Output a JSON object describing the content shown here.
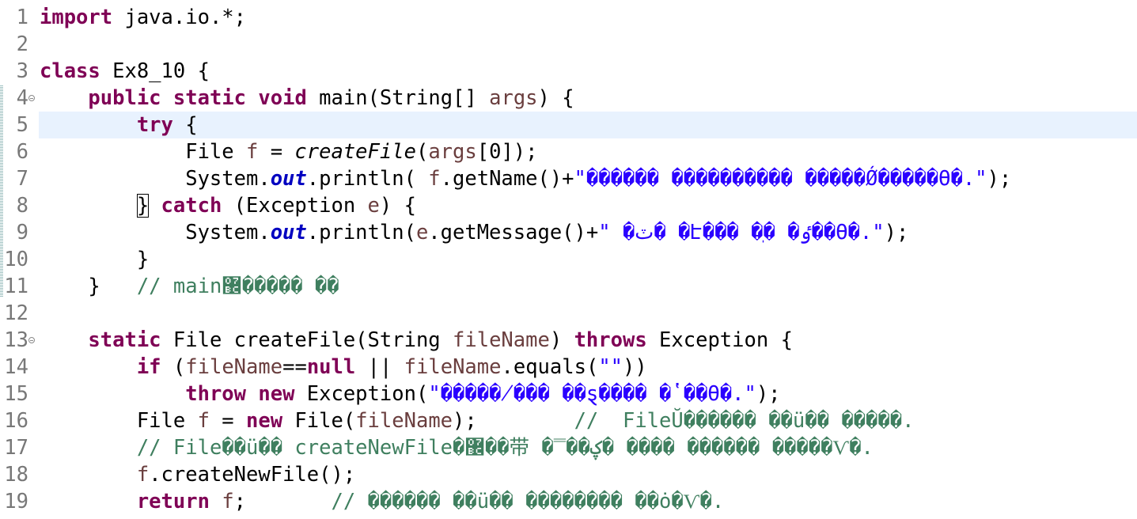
{
  "editor": {
    "language": "java",
    "current_line": 5,
    "lines": [
      {
        "n": "1",
        "fold": false,
        "tokens": [
          {
            "t": "import",
            "c": "kw"
          },
          {
            "t": " java.io.*;",
            "c": ""
          }
        ]
      },
      {
        "n": "2",
        "fold": false,
        "tokens": []
      },
      {
        "n": "3",
        "fold": false,
        "tokens": [
          {
            "t": "class",
            "c": "kw"
          },
          {
            "t": " Ex8_10 {",
            "c": ""
          }
        ]
      },
      {
        "n": "4",
        "fold": true,
        "tokens": [
          {
            "t": "    ",
            "c": ""
          },
          {
            "t": "public",
            "c": "kw"
          },
          {
            "t": " ",
            "c": ""
          },
          {
            "t": "static",
            "c": "kw"
          },
          {
            "t": " ",
            "c": ""
          },
          {
            "t": "void",
            "c": "kw"
          },
          {
            "t": " main(String[] ",
            "c": ""
          },
          {
            "t": "args",
            "c": "var"
          },
          {
            "t": ") {",
            "c": ""
          }
        ]
      },
      {
        "n": "5",
        "fold": false,
        "tokens": [
          {
            "t": "        ",
            "c": ""
          },
          {
            "t": "try",
            "c": "kw"
          },
          {
            "t": " {",
            "c": ""
          }
        ]
      },
      {
        "n": "6",
        "fold": false,
        "tokens": [
          {
            "t": "            File ",
            "c": ""
          },
          {
            "t": "f",
            "c": "var"
          },
          {
            "t": " = ",
            "c": ""
          },
          {
            "t": "createFile",
            "c": "ital"
          },
          {
            "t": "(",
            "c": ""
          },
          {
            "t": "args",
            "c": "var"
          },
          {
            "t": "[0]);",
            "c": ""
          }
        ]
      },
      {
        "n": "7",
        "fold": false,
        "tokens": [
          {
            "t": "            System.",
            "c": ""
          },
          {
            "t": "out",
            "c": "fld"
          },
          {
            "t": ".println( ",
            "c": ""
          },
          {
            "t": "f",
            "c": "var"
          },
          {
            "t": ".getName()+",
            "c": ""
          },
          {
            "t": "\"������ ���������� �����Ǿ�����ϴ�.\"",
            "c": "str"
          },
          {
            "t": ");",
            "c": ""
          }
        ]
      },
      {
        "n": "8",
        "fold": false,
        "tokens": [
          {
            "t": "        ",
            "c": ""
          },
          {
            "t": "}",
            "c": "bm"
          },
          {
            "t": " ",
            "c": ""
          },
          {
            "t": "catch",
            "c": "kw"
          },
          {
            "t": " (Exception ",
            "c": ""
          },
          {
            "t": "e",
            "c": "var"
          },
          {
            "t": ") {",
            "c": ""
          }
        ]
      },
      {
        "n": "9",
        "fold": false,
        "tokens": [
          {
            "t": "            System.",
            "c": ""
          },
          {
            "t": "out",
            "c": "fld"
          },
          {
            "t": ".println(",
            "c": ""
          },
          {
            "t": "e",
            "c": "var"
          },
          {
            "t": ".getMessage()+",
            "c": ""
          },
          {
            "t": "\" �ٽ� �Է��� �ֽ� �ٶ��ϴ�.\"",
            "c": "str"
          },
          {
            "t": ");",
            "c": ""
          }
        ]
      },
      {
        "n": "10",
        "fold": false,
        "tokens": [
          {
            "t": "        }",
            "c": ""
          }
        ]
      },
      {
        "n": "11",
        "fold": false,
        "tokens": [
          {
            "t": "    }   ",
            "c": ""
          },
          {
            "t": "// main޼����� ��",
            "c": "cmt"
          }
        ]
      },
      {
        "n": "12",
        "fold": false,
        "tokens": []
      },
      {
        "n": "13",
        "fold": true,
        "tokens": [
          {
            "t": "    ",
            "c": ""
          },
          {
            "t": "static",
            "c": "kw"
          },
          {
            "t": " File createFile(String ",
            "c": ""
          },
          {
            "t": "fileName",
            "c": "var"
          },
          {
            "t": ") ",
            "c": ""
          },
          {
            "t": "throws",
            "c": "kw"
          },
          {
            "t": " Exception {",
            "c": ""
          }
        ]
      },
      {
        "n": "14",
        "fold": false,
        "tokens": [
          {
            "t": "        ",
            "c": ""
          },
          {
            "t": "if",
            "c": "kw"
          },
          {
            "t": " (",
            "c": ""
          },
          {
            "t": "fileName",
            "c": "var"
          },
          {
            "t": "==",
            "c": ""
          },
          {
            "t": "null",
            "c": "kw"
          },
          {
            "t": " || ",
            "c": ""
          },
          {
            "t": "fileName",
            "c": "var"
          },
          {
            "t": ".equals(",
            "c": ""
          },
          {
            "t": "\"\"",
            "c": "str"
          },
          {
            "t": "))",
            "c": ""
          }
        ]
      },
      {
        "n": "15",
        "fold": false,
        "tokens": [
          {
            "t": "            ",
            "c": ""
          },
          {
            "t": "throw",
            "c": "kw"
          },
          {
            "t": " ",
            "c": ""
          },
          {
            "t": "new",
            "c": "kw"
          },
          {
            "t": " Exception(",
            "c": ""
          },
          {
            "t": "\"�����̸��� ��ȿ���� �ʽ��ϴ�.\"",
            "c": "str"
          },
          {
            "t": ");",
            "c": ""
          }
        ]
      },
      {
        "n": "16",
        "fold": false,
        "tokens": [
          {
            "t": "        File ",
            "c": ""
          },
          {
            "t": "f",
            "c": "var"
          },
          {
            "t": " = ",
            "c": ""
          },
          {
            "t": "new",
            "c": "kw"
          },
          {
            "t": " File(",
            "c": ""
          },
          {
            "t": "fileName",
            "c": "var"
          },
          {
            "t": ");        ",
            "c": ""
          },
          {
            "t": "//  FileŬ������ ��ü�� �����.",
            "c": "cmt"
          }
        ]
      },
      {
        "n": "17",
        "fold": false,
        "tokens": [
          {
            "t": "        ",
            "c": ""
          },
          {
            "t": "// File��ü�� createNewFile�޼��带 �̿��ؼ� ���� ������ �����Ѵ�.",
            "c": "cmt"
          }
        ]
      },
      {
        "n": "18",
        "fold": false,
        "tokens": [
          {
            "t": "        ",
            "c": ""
          },
          {
            "t": "f",
            "c": "var"
          },
          {
            "t": ".createNewFile();",
            "c": ""
          }
        ]
      },
      {
        "n": "19",
        "fold": false,
        "tokens": [
          {
            "t": "        ",
            "c": ""
          },
          {
            "t": "return",
            "c": "kw"
          },
          {
            "t": " ",
            "c": ""
          },
          {
            "t": "f",
            "c": "var"
          },
          {
            "t": ";       ",
            "c": ""
          },
          {
            "t": "// ������ ��ü�� �������� ��ȯ�Ѵ�.",
            "c": "cmt"
          }
        ]
      }
    ]
  }
}
